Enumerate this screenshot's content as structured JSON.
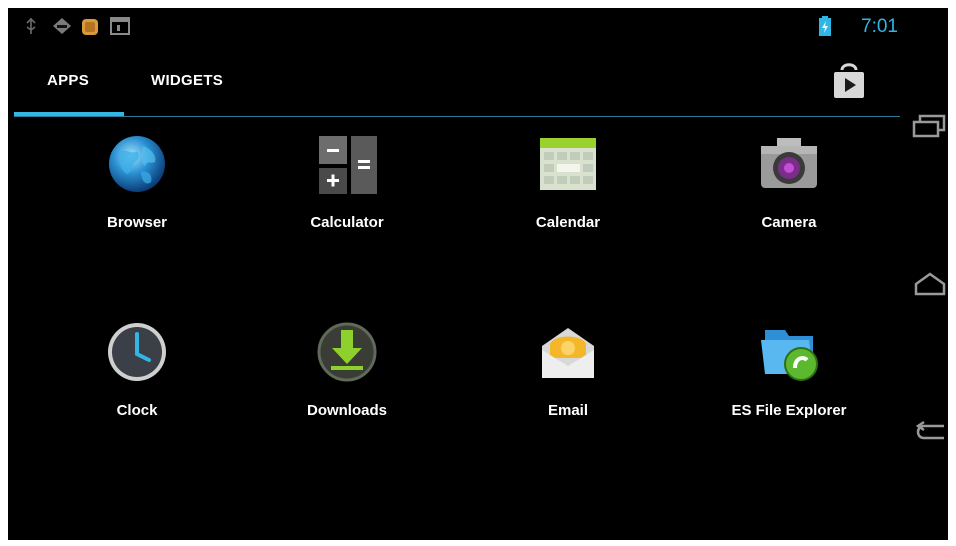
{
  "status_bar": {
    "time": "7:01",
    "left_icons": [
      "usb-icon",
      "android-debug-icon",
      "notification-app-icon",
      "screenshot-icon"
    ],
    "battery_icon": "battery-charging-icon"
  },
  "tabs": [
    {
      "label": "APPS",
      "selected": true
    },
    {
      "label": "WIDGETS",
      "selected": false
    }
  ],
  "store_button_icon": "play-store-icon",
  "apps": [
    {
      "label": "Browser",
      "icon": "browser-globe-icon"
    },
    {
      "label": "Calculator",
      "icon": "calculator-icon"
    },
    {
      "label": "Calendar",
      "icon": "calendar-icon"
    },
    {
      "label": "Camera",
      "icon": "camera-icon"
    },
    {
      "label": "Clock",
      "icon": "clock-icon"
    },
    {
      "label": "Downloads",
      "icon": "downloads-icon"
    },
    {
      "label": "Email",
      "icon": "email-icon"
    },
    {
      "label": "ES File Explorer",
      "icon": "es-file-explorer-icon"
    }
  ],
  "nav_bar": [
    "recent-apps-icon",
    "home-icon",
    "back-icon"
  ],
  "colors": {
    "accent": "#33b5e5",
    "background": "#000000",
    "text": "#ffffff"
  }
}
